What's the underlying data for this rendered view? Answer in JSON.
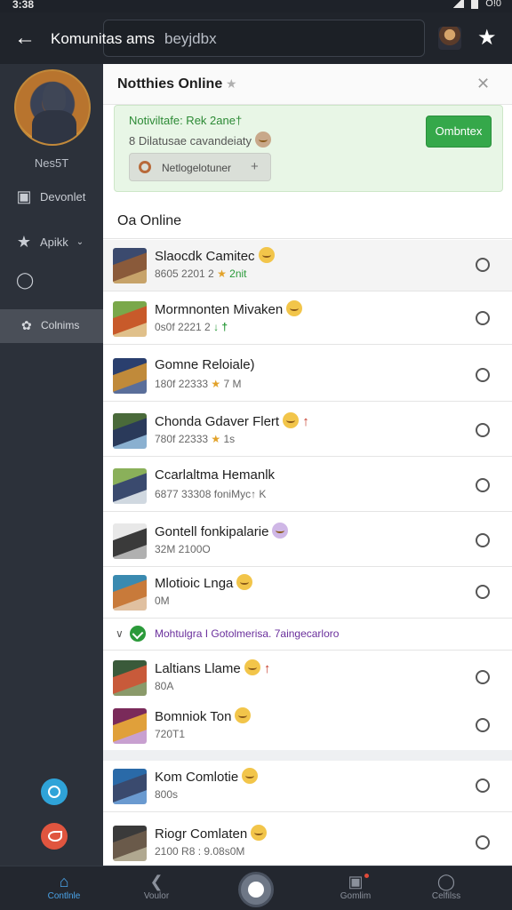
{
  "status_bar": {
    "time": "3:38",
    "right_text": "O!0"
  },
  "header": {
    "title": "Komunitas ams",
    "search_value": "beyjdbx"
  },
  "sidebar": {
    "profile_name": "Nes5T",
    "items": [
      {
        "label": "Devonlet",
        "icon": "square-icon"
      },
      {
        "label": "Apikk",
        "icon": "star-icon"
      },
      {
        "label": "",
        "icon": "person-icon"
      },
      {
        "label": "Colnims",
        "icon": "leaf-icon"
      }
    ]
  },
  "panel": {
    "title": "Notthies Online",
    "notification": {
      "title": "Notiviltafe: Rek 2ane†",
      "subtitle": "8 Dilatusae cavandeiaty",
      "chip_label": "Netlogelotuner",
      "chip_plus": "+",
      "action_label": "Ombntex"
    },
    "section_title": "Oa Online",
    "rows": [
      {
        "name": "Slaocdk Camitec",
        "sub": "8605 2201 2 ",
        "sub_tail": "2nit",
        "avatar": [
          "#3b4a6e",
          "#8a5a3a",
          "#c7a36a"
        ]
      },
      {
        "name": "Mormnonten Mivaken",
        "sub": "0s0f 2221 2 ",
        "sub_tail": "↓ †",
        "avatar": [
          "#7aa84a",
          "#c85a2a",
          "#e0c08a"
        ]
      },
      {
        "name": "Gomne Reloiale)",
        "sub": "180f 22333 ",
        "sub_tail": "7 M",
        "avatar": [
          "#2a3f6e",
          "#c08a3a",
          "#5a6e9a"
        ]
      },
      {
        "name": "Chonda Gdaver Flert",
        "sub": "780f 22333 ",
        "sub_tail": "1s",
        "avatar": [
          "#4a6a3a",
          "#2a3a5a",
          "#8ab0d0"
        ]
      },
      {
        "name": "Ccarlaltma Hemanlk",
        "sub": "6877 33308 foniMyc↑ K",
        "sub_tail": "",
        "avatar": [
          "#8ab05a",
          "#3a4a6e",
          "#d0d8e0"
        ]
      },
      {
        "name": "Gontell fonkipalarie",
        "sub": "32M 2100",
        "sub_tail": "O",
        "avatar": [
          "#e8e8e8",
          "#3a3a3a",
          "#b0b0b0"
        ]
      },
      {
        "name": "Mlotioic Lnga",
        "sub": "",
        "sub_tail": "0M",
        "avatar": [
          "#3a8ab0",
          "#c87a3a",
          "#e0c0a0"
        ]
      },
      {
        "name": "Laltians Llame",
        "sub": "",
        "sub_tail": "80A",
        "avatar": [
          "#3a5a3a",
          "#c85a3a",
          "#8a9a6a"
        ]
      },
      {
        "name": "Bomniok Ton",
        "sub": "720T1",
        "sub_tail": "",
        "avatar": [
          "#7a2a5a",
          "#e0a03a",
          "#c8a0d0"
        ]
      },
      {
        "name": "Kom Comlotie",
        "sub": "800s",
        "sub_tail": "",
        "avatar": [
          "#2a6aa8",
          "#3a4a6e",
          "#6a9ad0"
        ]
      },
      {
        "name": "Riogr Comlaten",
        "sub": "2100 R8 : 9.08",
        "sub_tail": "s0M",
        "avatar": [
          "#3a3a3a",
          "#6a5a4a",
          "#b0a890"
        ]
      }
    ],
    "subnote": "Mohtulgra I Gotolmerisa. 7aingecarloro"
  },
  "bottom_nav": [
    {
      "label": "Contlnle",
      "icon": "home-icon"
    },
    {
      "label": "Voulor",
      "icon": "back-icon"
    },
    {
      "label": "Gomlim",
      "icon": "tray-icon"
    },
    {
      "label": "Celfilss",
      "icon": "user-icon"
    }
  ],
  "colors": {
    "accent_green": "#35a84a",
    "nav_active": "#4aa3e8",
    "sidebar_bg": "#2c313a"
  }
}
